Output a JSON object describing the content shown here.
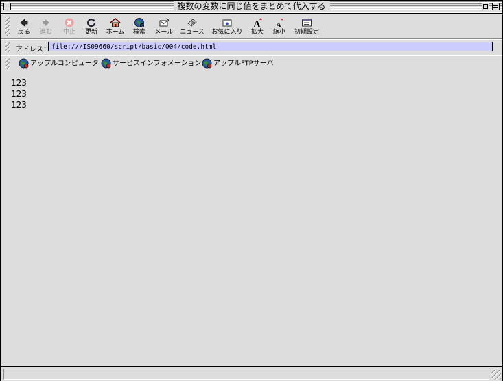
{
  "window": {
    "title": "複数の変数に同じ値をまとめて代入する"
  },
  "toolbar": {
    "buttons": [
      {
        "label": "戻る",
        "icon": "back-arrow-icon",
        "enabled": true
      },
      {
        "label": "進む",
        "icon": "forward-arrow-icon",
        "enabled": false
      },
      {
        "label": "中止",
        "icon": "stop-icon",
        "enabled": false
      },
      {
        "label": "更新",
        "icon": "refresh-icon",
        "enabled": true
      },
      {
        "label": "ホーム",
        "icon": "home-icon",
        "enabled": true
      },
      {
        "label": "検索",
        "icon": "search-globe-icon",
        "enabled": true
      },
      {
        "label": "メール",
        "icon": "mail-icon",
        "enabled": true
      },
      {
        "label": "ニュース",
        "icon": "news-icon",
        "enabled": true
      },
      {
        "label": "お気に入り",
        "icon": "favorites-icon",
        "enabled": true
      },
      {
        "label": "拡大",
        "icon": "text-larger-icon",
        "enabled": true
      },
      {
        "label": "縮小",
        "icon": "text-smaller-icon",
        "enabled": true
      },
      {
        "label": "初期設定",
        "icon": "preferences-icon",
        "enabled": true
      }
    ]
  },
  "address": {
    "label": "アドレス：",
    "value": "file:///IS09660/script/basic/004/code.html"
  },
  "favorites": {
    "items": [
      {
        "label": "アップルコンピュータ",
        "icon": "globe-icon"
      },
      {
        "label": "サービスインフォメーション",
        "icon": "globe-icon"
      },
      {
        "label": "アップルFTPサーバ",
        "icon": "globe-icon"
      }
    ]
  },
  "content": {
    "lines": [
      "123",
      "123",
      "123"
    ]
  },
  "colors": {
    "chrome": "#dddddd",
    "address_field": "#ccccff"
  }
}
